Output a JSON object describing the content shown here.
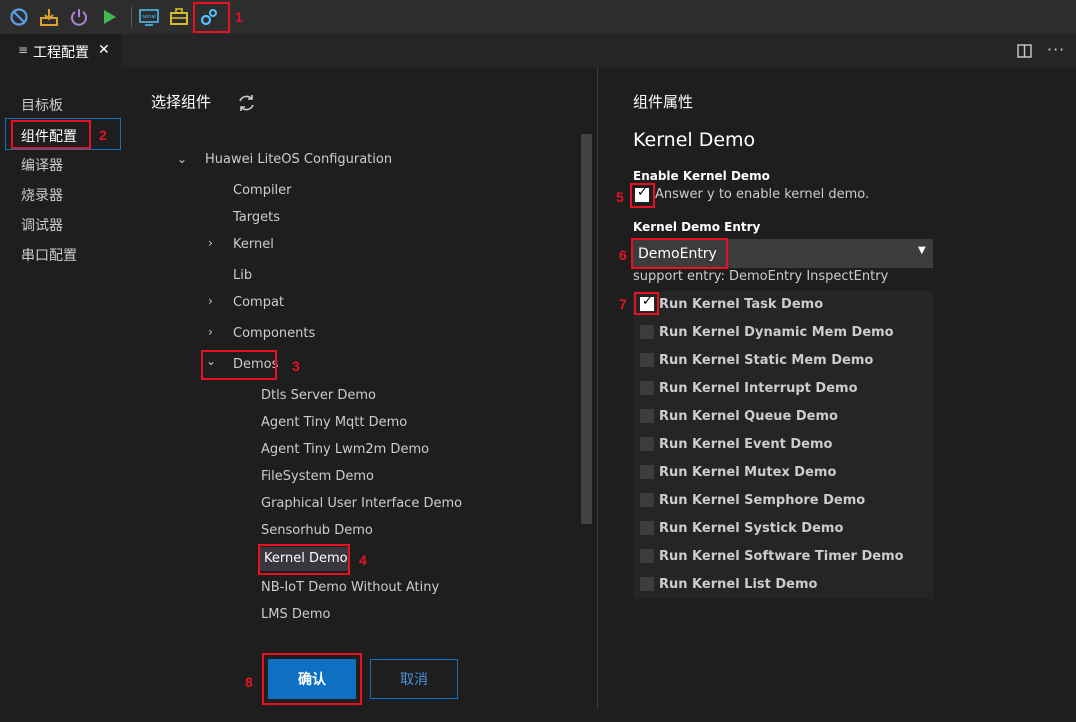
{
  "toolbar": {
    "icons": [
      "prohibit-icon",
      "download-icon",
      "power-icon",
      "run-icon",
      "serial-icon",
      "toolbox-icon",
      "settings-gears-icon"
    ]
  },
  "tab": {
    "title": "工程配置",
    "close": "✕"
  },
  "sidebar": {
    "items": [
      {
        "label": "目标板"
      },
      {
        "label": "组件配置"
      },
      {
        "label": "编译器"
      },
      {
        "label": "烧录器"
      },
      {
        "label": "调试器"
      },
      {
        "label": "串口配置"
      }
    ]
  },
  "select_panel": {
    "title": "选择组件",
    "tree": {
      "root": "Huawei LiteOS Configuration",
      "level1": [
        "Compiler",
        "Targets",
        "Kernel",
        "Lib",
        "Compat",
        "Components",
        "Demos"
      ],
      "demos": [
        "Dtls Server Demo",
        "Agent Tiny Mqtt Demo",
        "Agent Tiny Lwm2m Demo",
        "FileSystem Demo",
        "Graphical User Interface Demo",
        "Sensorhub Demo",
        "Kernel Demo",
        "NB-IoT Demo Without Atiny",
        "LMS Demo"
      ]
    }
  },
  "buttons": {
    "confirm": "确认",
    "cancel": "取消"
  },
  "props": {
    "header": "组件属性",
    "component_title": "Kernel Demo",
    "enable_label": "Enable Kernel Demo",
    "enable_desc": "Answer y to enable kernel demo.",
    "entry_label": "Kernel Demo Entry",
    "entry_value": "DemoEntry",
    "entry_support": "support entry: DemoEntry InspectEntry",
    "options": [
      {
        "label": "Run Kernel Task Demo",
        "checked": true
      },
      {
        "label": "Run Kernel Dynamic Mem Demo",
        "checked": false
      },
      {
        "label": "Run Kernel Static Mem Demo",
        "checked": false
      },
      {
        "label": "Run Kernel Interrupt Demo",
        "checked": false
      },
      {
        "label": "Run Kernel Queue Demo",
        "checked": false
      },
      {
        "label": "Run Kernel Event Demo",
        "checked": false
      },
      {
        "label": "Run Kernel Mutex Demo",
        "checked": false
      },
      {
        "label": "Run Kernel Semphore Demo",
        "checked": false
      },
      {
        "label": "Run Kernel Systick Demo",
        "checked": false
      },
      {
        "label": "Run Kernel Software Timer Demo",
        "checked": false
      },
      {
        "label": "Run Kernel List Demo",
        "checked": false
      }
    ]
  },
  "annotations": [
    "1",
    "2",
    "3",
    "4",
    "5",
    "6",
    "7",
    "8"
  ],
  "colors": {
    "accent": "#0e70c0",
    "annotation": "#e81123",
    "background": "#1e1e1e"
  }
}
